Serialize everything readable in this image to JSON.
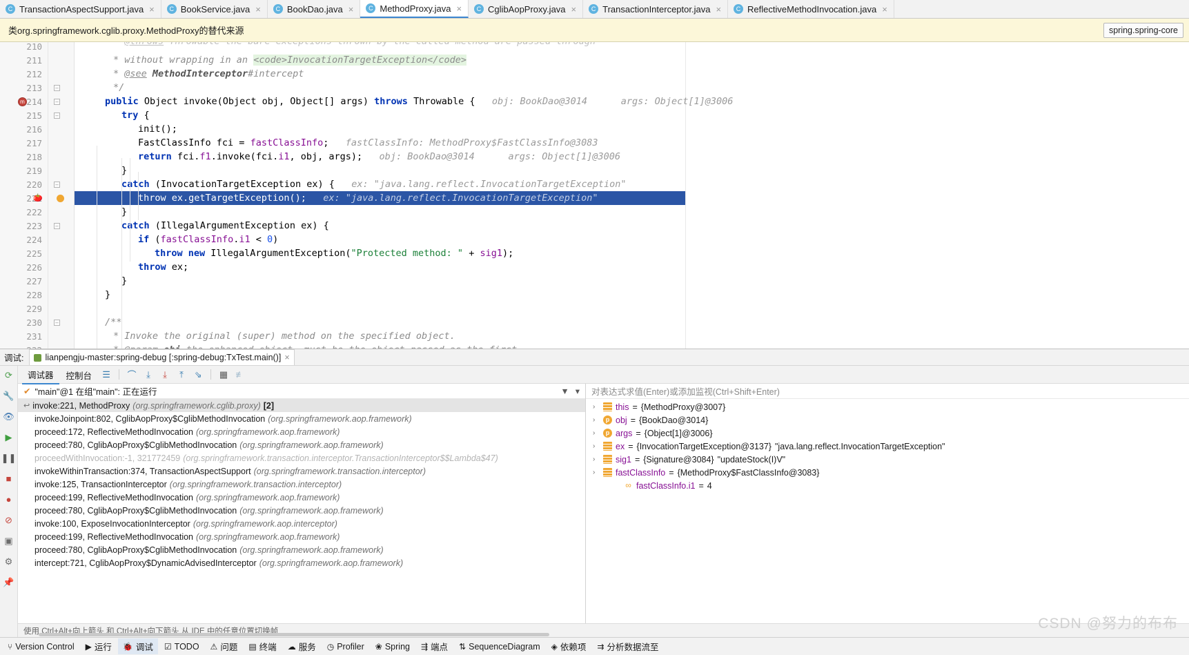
{
  "tabs": [
    {
      "label": "TransactionAspectSupport.java",
      "icon": "java-class-icon",
      "active": false
    },
    {
      "label": "BookService.java",
      "icon": "java-class-icon",
      "active": false
    },
    {
      "label": "BookDao.java",
      "icon": "java-class-icon",
      "active": false
    },
    {
      "label": "MethodProxy.java",
      "icon": "java-class-icon",
      "active": true
    },
    {
      "label": "CglibAopProxy.java",
      "icon": "java-class-icon",
      "active": false
    },
    {
      "label": "TransactionInterceptor.java",
      "icon": "java-class-icon",
      "active": false
    },
    {
      "label": "ReflectiveMethodInvocation.java",
      "icon": "java-class-icon",
      "active": false
    }
  ],
  "notification": {
    "message": "类org.springframework.cglib.proxy.MethodProxy的替代来源",
    "chip": "spring.spring-core"
  },
  "editor": {
    "first_line": 210,
    "caret_line": 221,
    "breakpoint_line": 214,
    "lines": [
      {
        "n": 210,
        "partial": true,
        "text": "* @throws Throwable the bare exceptions thrown by the called method are passed through"
      },
      {
        "n": 211,
        "text": "* without wrapping in an <code>InvocationTargetException</code>"
      },
      {
        "n": 212,
        "text": "* @see MethodInterceptor#intercept"
      },
      {
        "n": 213,
        "text": "*/"
      },
      {
        "n": 214,
        "text": "public Object invoke(Object obj, Object[] args) throws Throwable {",
        "hints": "obj: BookDao@3014      args: Object[1]@3006"
      },
      {
        "n": 215,
        "text": "try {"
      },
      {
        "n": 216,
        "text": "init();"
      },
      {
        "n": 217,
        "text": "FastClassInfo fci = fastClassInfo;",
        "hints": "fastClassInfo: MethodProxy$FastClassInfo@3083"
      },
      {
        "n": 218,
        "text": "return fci.f1.invoke(fci.i1, obj, args);",
        "hints": "obj: BookDao@3014      args: Object[1]@3006"
      },
      {
        "n": 219,
        "text": "}"
      },
      {
        "n": 220,
        "text": "catch (InvocationTargetException ex) {",
        "hints": "ex: \"java.lang.reflect.InvocationTargetException\""
      },
      {
        "n": 221,
        "text": "throw ex.getTargetException();",
        "hints": "ex: \"java.lang.reflect.InvocationTargetException\"",
        "selected": true
      },
      {
        "n": 222,
        "text": "}"
      },
      {
        "n": 223,
        "text": "catch (IllegalArgumentException ex) {"
      },
      {
        "n": 224,
        "text": "if (fastClassInfo.i1 < 0)"
      },
      {
        "n": 225,
        "text": "throw new IllegalArgumentException(\"Protected method: \" + sig1);"
      },
      {
        "n": 226,
        "text": "throw ex;"
      },
      {
        "n": 227,
        "text": "}"
      },
      {
        "n": 228,
        "text": "}"
      },
      {
        "n": 229,
        "text": ""
      },
      {
        "n": 230,
        "text": "/**"
      },
      {
        "n": 231,
        "text": "* Invoke the original (super) method on the specified object."
      },
      {
        "n": 232,
        "text": "* @param obj the enhanced object, must be the object passed as the first"
      }
    ]
  },
  "debug": {
    "session_label": "调试:",
    "session_tab": "lianpengju-master:spring-debug [:spring-debug:TxTest.main()]",
    "session_close": "×",
    "tabs": [
      {
        "label": "调试器",
        "active": true
      },
      {
        "label": "控制台",
        "active": false
      }
    ],
    "toolbar_icons": [
      "layout-icon",
      "step-over-icon",
      "step-into-icon",
      "force-step-into-icon",
      "step-out-icon",
      "run-to-cursor-icon",
      "evaluate-expression-icon",
      "mute-breakpoints-icon"
    ],
    "rail_icons": [
      "rerun-icon",
      "settings-icon",
      "eye-icon",
      "resume-icon",
      "pause-icon",
      "stop-icon",
      "breakpoints-icon",
      "mute-breakpoints-icon",
      "camera-icon",
      "layout-settings-icon",
      "pin-icon"
    ],
    "thread": {
      "status_icon": "check-icon",
      "text": "\"main\"@1 在组\"main\": 正在运行",
      "filter_icon": "filter-icon",
      "dropdown_icon": "chevron-down-icon"
    },
    "frames": [
      {
        "method": "invoke:221, MethodProxy",
        "pkg": "(org.springframework.cglib.proxy)",
        "count": "[2]",
        "selected": true,
        "dim": false
      },
      {
        "method": "invokeJoinpoint:802, CglibAopProxy$CglibMethodInvocation",
        "pkg": "(org.springframework.aop.framework)",
        "count": "",
        "selected": false,
        "dim": false
      },
      {
        "method": "proceed:172, ReflectiveMethodInvocation",
        "pkg": "(org.springframework.aop.framework)",
        "count": "",
        "selected": false,
        "dim": false
      },
      {
        "method": "proceed:780, CglibAopProxy$CglibMethodInvocation",
        "pkg": "(org.springframework.aop.framework)",
        "count": "",
        "selected": false,
        "dim": false
      },
      {
        "method": "proceedWithInvocation:-1, 321772459",
        "pkg": "(org.springframework.transaction.interceptor.TransactionInterceptor$$Lambda$47)",
        "count": "",
        "selected": false,
        "dim": true
      },
      {
        "method": "invokeWithinTransaction:374, TransactionAspectSupport",
        "pkg": "(org.springframework.transaction.interceptor)",
        "count": "",
        "selected": false,
        "dim": false
      },
      {
        "method": "invoke:125, TransactionInterceptor",
        "pkg": "(org.springframework.transaction.interceptor)",
        "count": "",
        "selected": false,
        "dim": false
      },
      {
        "method": "proceed:199, ReflectiveMethodInvocation",
        "pkg": "(org.springframework.aop.framework)",
        "count": "",
        "selected": false,
        "dim": false
      },
      {
        "method": "proceed:780, CglibAopProxy$CglibMethodInvocation",
        "pkg": "(org.springframework.aop.framework)",
        "count": "",
        "selected": false,
        "dim": false
      },
      {
        "method": "invoke:100, ExposeInvocationInterceptor",
        "pkg": "(org.springframework.aop.interceptor)",
        "count": "",
        "selected": false,
        "dim": false
      },
      {
        "method": "proceed:199, ReflectiveMethodInvocation",
        "pkg": "(org.springframework.aop.framework)",
        "count": "",
        "selected": false,
        "dim": false
      },
      {
        "method": "proceed:780, CglibAopProxy$CglibMethodInvocation",
        "pkg": "(org.springframework.aop.framework)",
        "count": "",
        "selected": false,
        "dim": false
      },
      {
        "method": "intercept:721, CglibAopProxy$DynamicAdvisedInterceptor",
        "pkg": "(org.springframework.aop.framework)",
        "count": "",
        "selected": false,
        "dim": false
      }
    ],
    "watch_placeholder": "对表达式求值(Enter)或添加监视(Ctrl+Shift+Enter)",
    "variables": [
      {
        "chev": "›",
        "icon": "field-icon",
        "name": "this",
        "eq": "=",
        "value": "{MethodProxy@3007}",
        "extra": "",
        "indent": false
      },
      {
        "chev": "›",
        "icon": "param-icon",
        "name": "obj",
        "eq": "=",
        "value": "{BookDao@3014}",
        "extra": "",
        "indent": false
      },
      {
        "chev": "›",
        "icon": "param-icon",
        "name": "args",
        "eq": "=",
        "value": "{Object[1]@3006}",
        "extra": "",
        "indent": false
      },
      {
        "chev": "›",
        "icon": "field-icon",
        "name": "ex",
        "eq": "=",
        "value": "{InvocationTargetException@3137}",
        "extra": "\"java.lang.reflect.InvocationTargetException\"",
        "indent": false
      },
      {
        "chev": "›",
        "icon": "field-icon",
        "name": "sig1",
        "eq": "=",
        "value": "{Signature@3084}",
        "extra": "\"updateStock(I)V\"",
        "indent": false
      },
      {
        "chev": "›",
        "icon": "field-icon",
        "name": "fastClassInfo",
        "eq": "=",
        "value": "{MethodProxy$FastClassInfo@3083}",
        "extra": "",
        "indent": false
      },
      {
        "chev": "",
        "icon": "primitive-icon",
        "name": "fastClassInfo.i1",
        "eq": "=",
        "value": "4",
        "extra": "",
        "indent": true
      }
    ],
    "hint_text": "使用 Ctrl+Alt+向上箭头 和 Ctrl+Alt+向下箭头 从 IDE 中的任意位置切换帧"
  },
  "statusbar": [
    {
      "label": "Version Control",
      "icon": "branch-icon",
      "active": false
    },
    {
      "label": "运行",
      "icon": "run-icon",
      "active": false
    },
    {
      "label": "调试",
      "icon": "debug-icon",
      "active": true
    },
    {
      "label": "TODO",
      "icon": "todo-icon",
      "active": false
    },
    {
      "label": "问题",
      "icon": "problems-icon",
      "active": false
    },
    {
      "label": "终端",
      "icon": "terminal-icon",
      "active": false
    },
    {
      "label": "服务",
      "icon": "services-icon",
      "active": false
    },
    {
      "label": "Profiler",
      "icon": "profiler-icon",
      "active": false
    },
    {
      "label": "Spring",
      "icon": "spring-icon",
      "active": false
    },
    {
      "label": "端点",
      "icon": "endpoints-icon",
      "active": false
    },
    {
      "label": "SequenceDiagram",
      "icon": "sequence-icon",
      "active": false
    },
    {
      "label": "依赖项",
      "icon": "dependencies-icon",
      "active": false
    },
    {
      "label": "分析数据流至",
      "icon": "dataflow-icon",
      "active": false
    }
  ],
  "watermark": "CSDN @努力的布布"
}
